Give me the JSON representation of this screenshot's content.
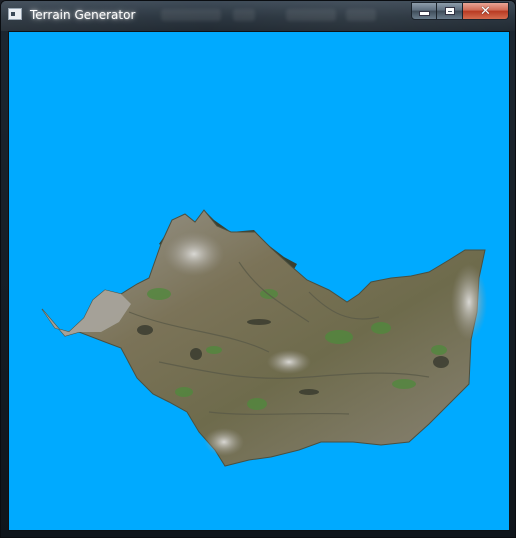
{
  "window": {
    "title": "Terrain Generator",
    "app_icon": "window-app-icon",
    "controls": {
      "minimize_icon": "minimize-icon",
      "maximize_icon": "maximize-icon",
      "close_icon": "close-icon",
      "close_glyph": "✕"
    }
  },
  "viewport": {
    "background_color": "#00aaff",
    "scene": "3d-terrain-mesh",
    "terrain_colors": {
      "rock": "#a9a6a0",
      "soil": "#7d7257",
      "grass": "#4f8a3c",
      "shadow": "#2f3329"
    }
  }
}
